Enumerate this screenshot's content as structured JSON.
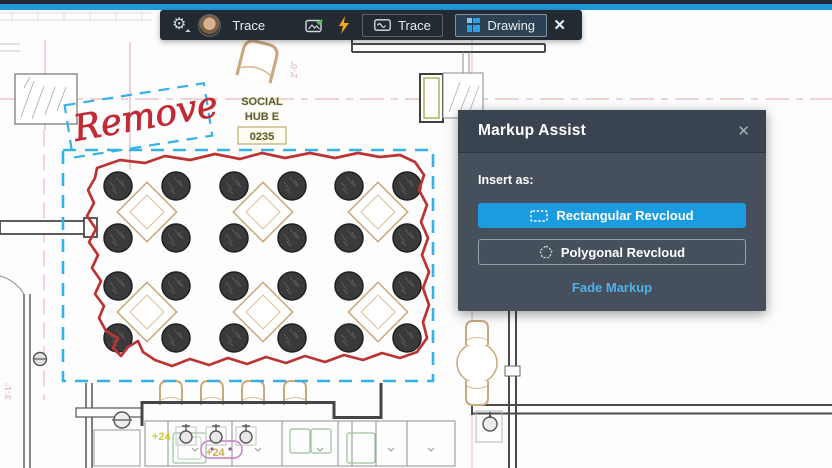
{
  "chrome": {
    "top_bar_color": "#23272e",
    "accent_strip_color": "#2196d8"
  },
  "toolbar": {
    "settings_glyph": "⚙",
    "trace_name_label": "Trace",
    "trace_button_label": "Trace",
    "drawing_button_label": "Drawing",
    "close_glyph": "✕"
  },
  "panel": {
    "title": "Markup Assist",
    "close_glyph": "✕",
    "insert_as_label": "Insert as:",
    "rect_button_label": "Rectangular Revcloud",
    "poly_button_label": "Polygonal Revcloud",
    "fade_link_label": "Fade Markup",
    "accent_color": "#1b9ce0"
  },
  "drawing": {
    "markup_text": "Remove",
    "room_label": {
      "line1": "SOCIAL",
      "line2": "HUB E",
      "number": "0235"
    },
    "annotations": {
      "counter_height_a": "+24",
      "counter_height_b": "+24",
      "dim_vertical_top": "2'-0\"",
      "dim_vertical_left": "3'-1\""
    },
    "colors": {
      "markup_red": "#bb3333",
      "selection_blue": "#35b1ea",
      "furniture_tan": "#c9a87c",
      "highlight_yellow": "#cfcf3a",
      "fixture_magenta": "#c478c4",
      "centerline_pink": "#e4b9b9"
    }
  }
}
